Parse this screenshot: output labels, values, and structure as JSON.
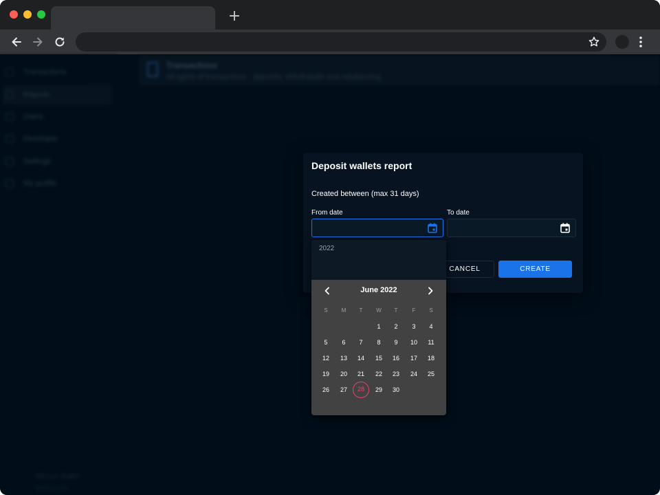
{
  "browser": {
    "new_tab_symbol": "+"
  },
  "sidebar": {
    "items": [
      {
        "label": "Transactions",
        "icon": "transactions-icon",
        "active": false
      },
      {
        "label": "Reports",
        "icon": "reports-icon",
        "active": true
      },
      {
        "label": "Users",
        "icon": "users-icon",
        "active": false
      },
      {
        "label": "Developer",
        "icon": "code-icon",
        "active": false
      },
      {
        "label": "Settings",
        "icon": "settings-icon",
        "active": false
      },
      {
        "label": "My profile",
        "icon": "profile-icon",
        "active": false
      }
    ],
    "footer_name": "Bitnovo Wallet",
    "footer_sub": "bitnovo.com"
  },
  "header": {
    "title": "Transactions",
    "subtitle": "All types of transactions - deposits, withdrawals and rebalancing"
  },
  "dialog": {
    "title": "Deposit wallets report",
    "subtitle": "Created between (max 31 days)",
    "from_label": "From date",
    "to_label": "To date",
    "cancel_label": "CANCEL",
    "create_label": "CREATE"
  },
  "picker": {
    "year": "2022",
    "month": "June 2022",
    "weekdays": [
      "S",
      "M",
      "T",
      "W",
      "T",
      "F",
      "S"
    ],
    "first_weekday_index": 3,
    "days": [
      "1",
      "2",
      "3",
      "4",
      "5",
      "6",
      "7",
      "8",
      "9",
      "10",
      "11",
      "12",
      "13",
      "14",
      "15",
      "16",
      "17",
      "18",
      "19",
      "20",
      "21",
      "22",
      "23",
      "24",
      "25",
      "26",
      "27",
      "28",
      "29",
      "30"
    ],
    "today": "28"
  },
  "colors": {
    "accent": "#1a73e8",
    "today": "#e8436e",
    "background": "#010d18"
  }
}
